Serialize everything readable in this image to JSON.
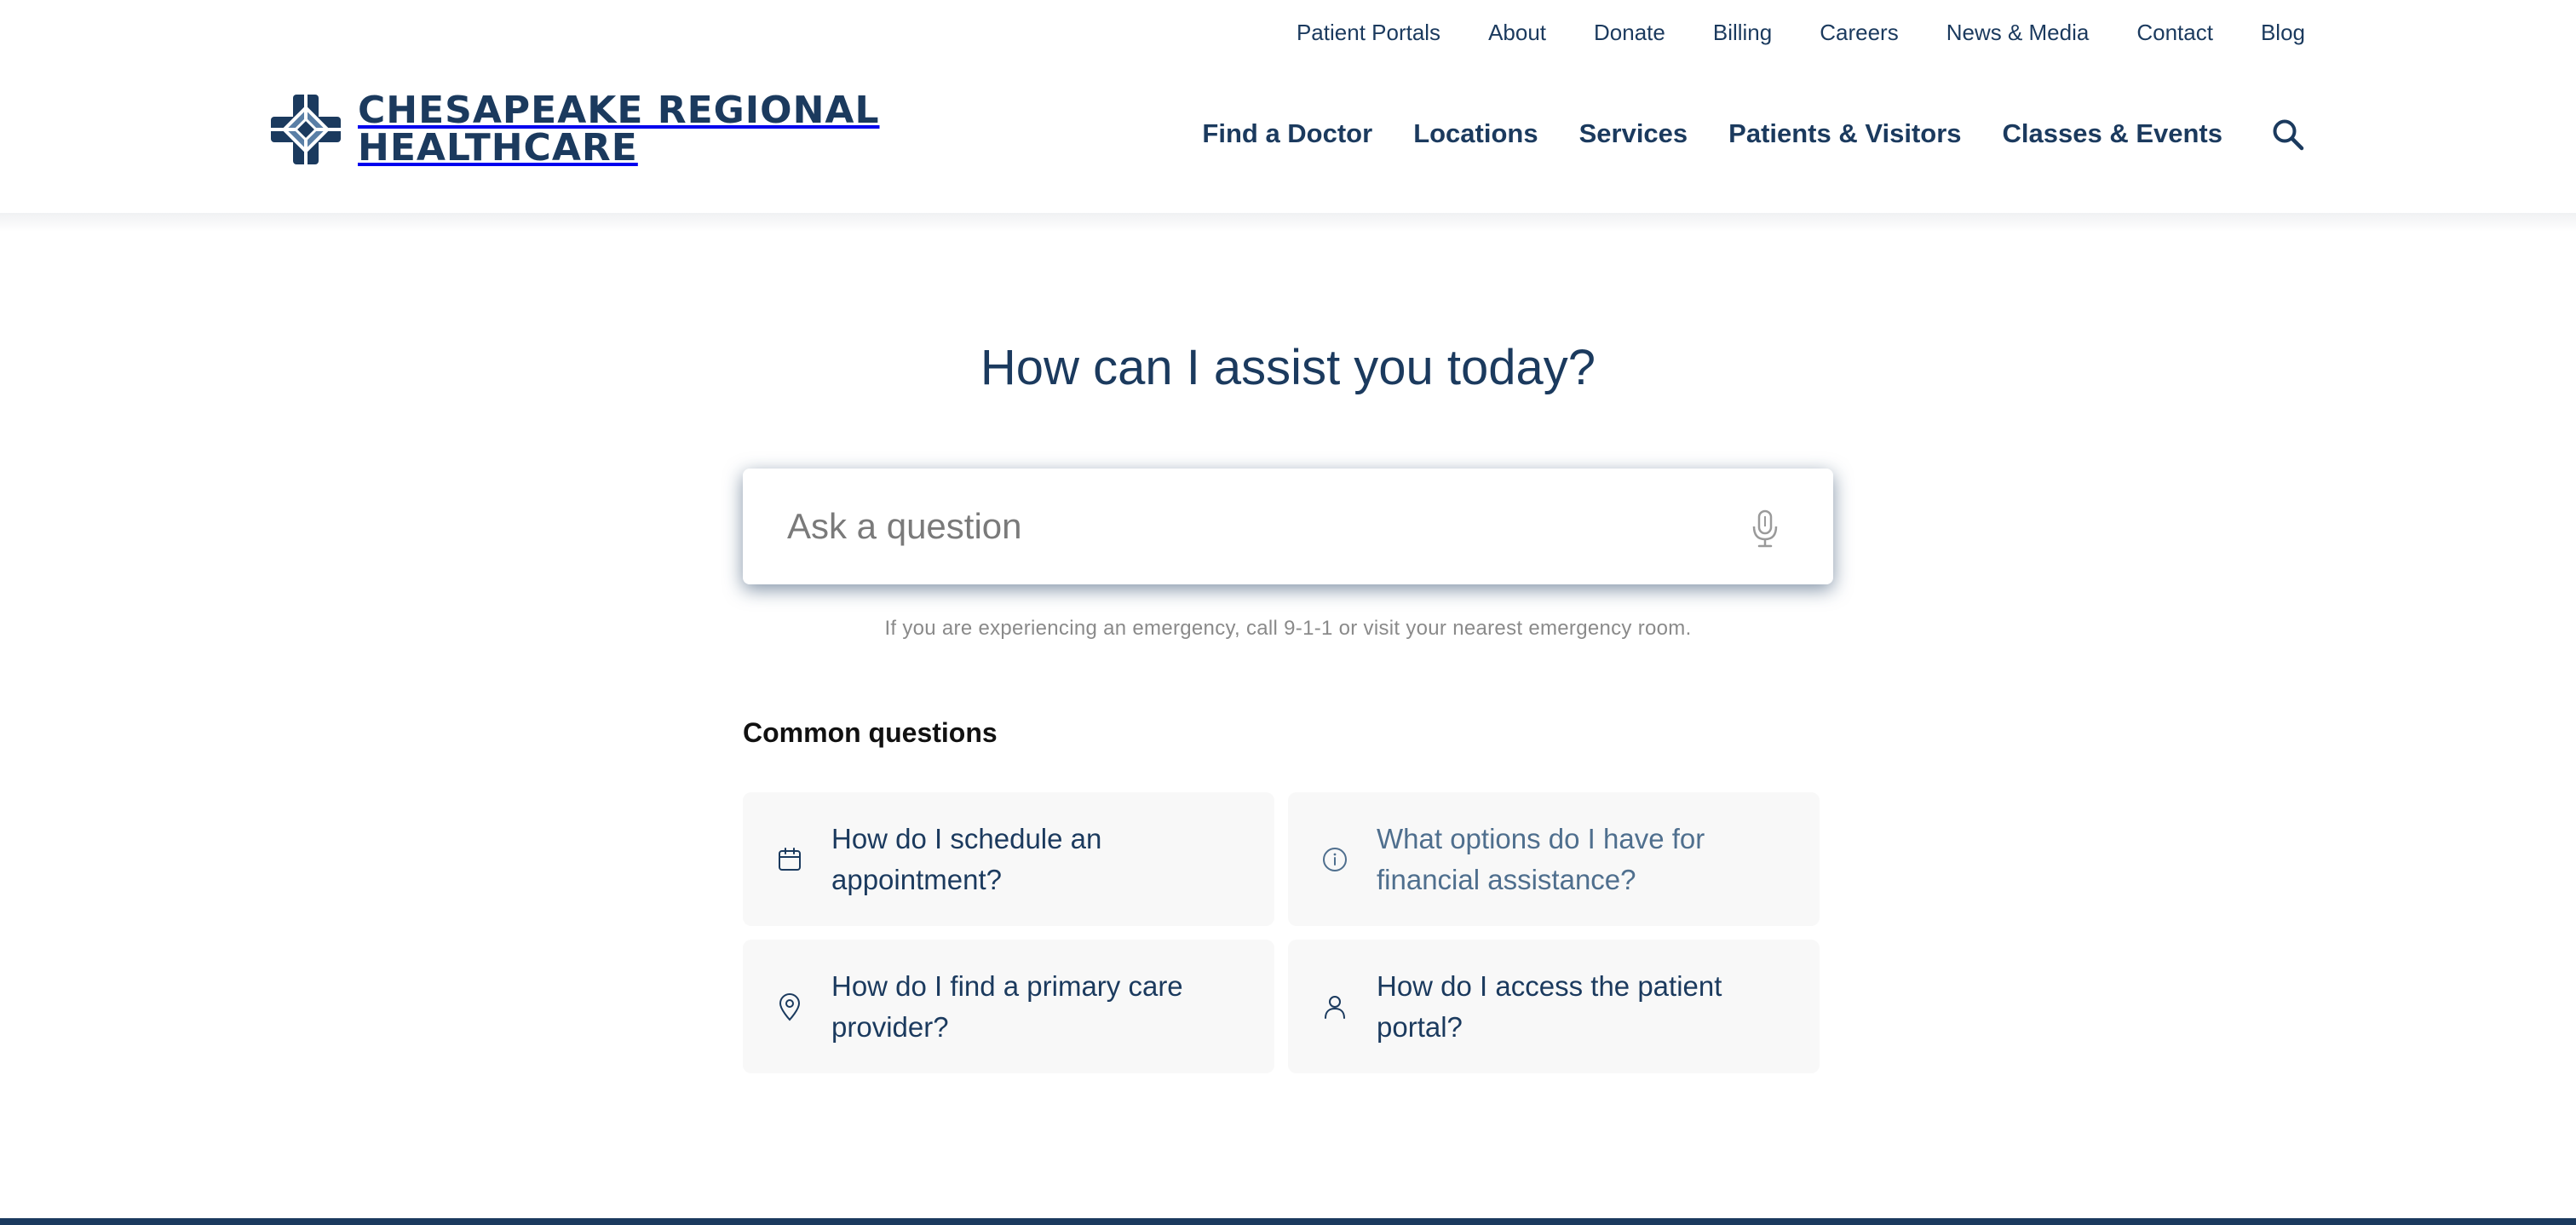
{
  "header": {
    "utility_nav": [
      "Patient Portals",
      "About",
      "Donate",
      "Billing",
      "Careers",
      "News & Media",
      "Contact",
      "Blog"
    ],
    "logo": {
      "line1": "CHESAPEAKE REGIONAL",
      "line2": "HEALTHCARE"
    },
    "main_nav": [
      "Find a Doctor",
      "Locations",
      "Services",
      "Patients & Visitors",
      "Classes & Events"
    ],
    "search_icon": "search-icon"
  },
  "assistant": {
    "title": "How can I assist you today?",
    "input_placeholder": "Ask a question",
    "input_value": "",
    "mic_icon": "microphone-icon",
    "disclaimer": "If you are experiencing an emergency, call 9-1-1 or visit your nearest emergency room.",
    "common_heading": "Common questions",
    "questions": [
      {
        "text": "How do I schedule an appointment?",
        "icon": "calendar-icon"
      },
      {
        "text": "What options do I have for financial assistance?",
        "icon": "info-icon"
      },
      {
        "text": "How do I find a primary care provider?",
        "icon": "map-pin-icon"
      },
      {
        "text": "How do I access the patient portal?",
        "icon": "user-icon"
      }
    ]
  },
  "colors": {
    "brand_navy": "#1b3a5e",
    "brand_steel": "#5a7fa6",
    "card_background": "#f8f8f8",
    "muted_text": "#8a8a8a"
  }
}
